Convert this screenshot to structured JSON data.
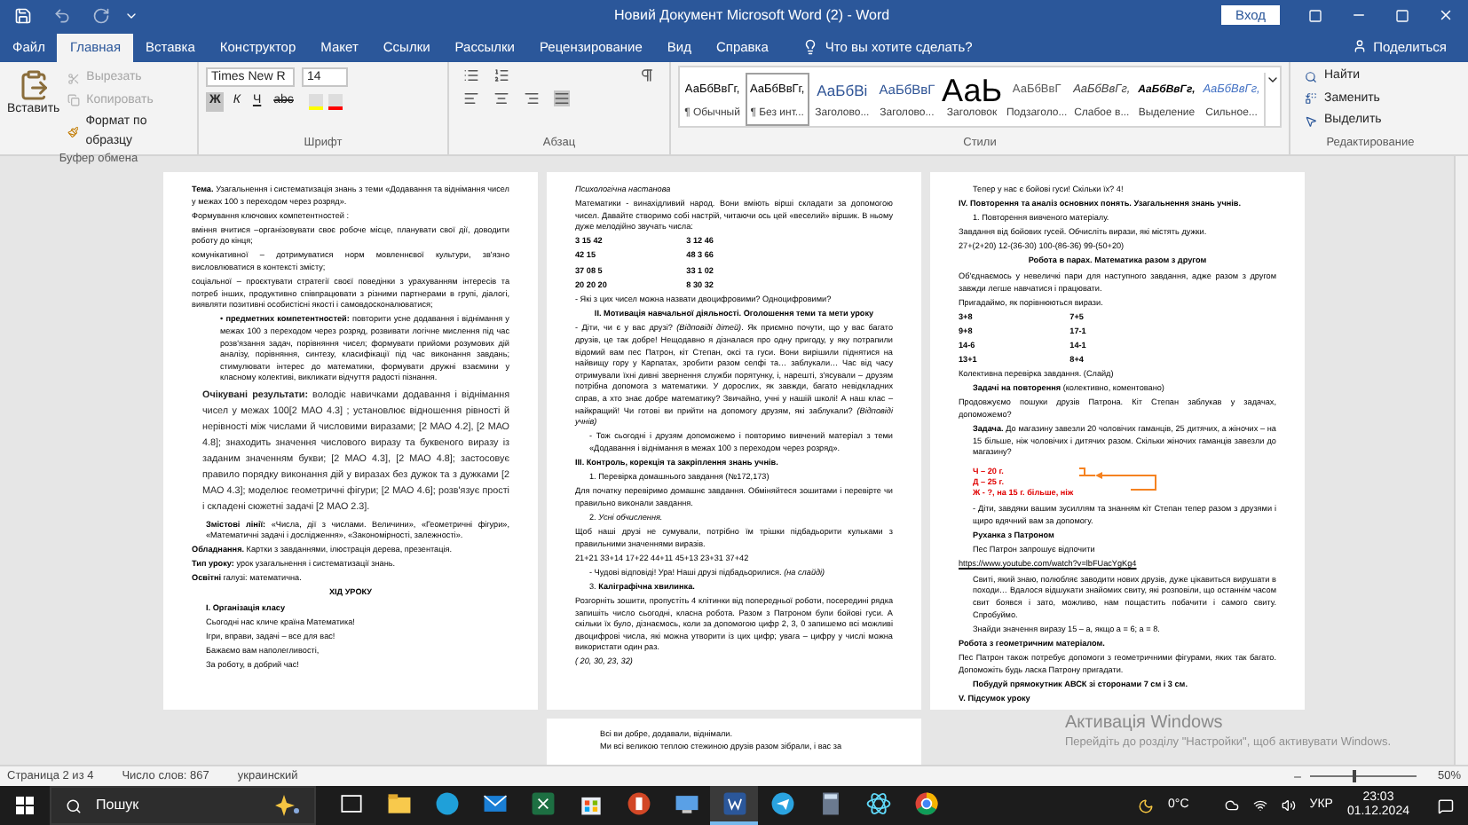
{
  "title_bar": {
    "title": "Новий Документ Microsoft Word (2)  -  Word",
    "sign_in": "Вход"
  },
  "tabs": [
    {
      "label": "Файл",
      "selected": false
    },
    {
      "label": "Главная",
      "selected": true
    },
    {
      "label": "Вставка",
      "selected": false
    },
    {
      "label": "Конструктор",
      "selected": false
    },
    {
      "label": "Макет",
      "selected": false
    },
    {
      "label": "Ссылки",
      "selected": false
    },
    {
      "label": "Рассылки",
      "selected": false
    },
    {
      "label": "Рецензирование",
      "selected": false
    },
    {
      "label": "Вид",
      "selected": false
    },
    {
      "label": "Справка",
      "selected": false
    }
  ],
  "tell_me": "Что вы хотите сделать?",
  "share": "Поделиться",
  "clipboard": {
    "paste": "Вставить",
    "items": [
      {
        "kind": "cut",
        "label": "Вырезать",
        "disabled": true
      },
      {
        "kind": "copy",
        "label": "Копировать",
        "disabled": true
      },
      {
        "kind": "format",
        "label": "Формат по образцу",
        "disabled": false
      }
    ],
    "group": "Буфер обмена"
  },
  "font": {
    "name": "Times New R",
    "size": "14",
    "buttons": [
      {
        "kind": "bold",
        "label": "Ж",
        "selected": true
      },
      {
        "kind": "italic",
        "label": "К",
        "selected": false
      },
      {
        "kind": "underline",
        "label": "Ч",
        "selected": false
      },
      {
        "kind": "strike",
        "label": "abc",
        "selected": false
      }
    ],
    "group": "Шрифт"
  },
  "paragraph": {
    "group": "Абзац"
  },
  "styles": {
    "group": "Стили",
    "items": [
      {
        "kind": "normal",
        "preview": "АаБбВвГг,",
        "label": "¶ Обычный",
        "selected": false
      },
      {
        "kind": "normal",
        "preview": "АаБбВвГг,",
        "label": "¶ Без инт...",
        "selected": true
      },
      {
        "kind": "heading1",
        "preview": "АаБбВі",
        "label": "Заголово...",
        "selected": false
      },
      {
        "kind": "heading2",
        "preview": "АаБбВвГ",
        "label": "Заголово...",
        "selected": false
      },
      {
        "kind": "title",
        "preview": "АаЬ",
        "label": "Заголовок",
        "selected": false
      },
      {
        "kind": "subtitle",
        "preview": "АаБбВвГ",
        "label": "Подзаголо...",
        "selected": false
      },
      {
        "kind": "emphasis",
        "preview": "АаБбВвГг,",
        "label": "Слабое в...",
        "selected": false
      },
      {
        "kind": "strong",
        "preview": "АаБбВвГг,",
        "label": "Выделение",
        "selected": false
      },
      {
        "kind": "intense",
        "preview": "АаБбВвГг,",
        "label": "Сильное...",
        "selected": false
      }
    ]
  },
  "editing": {
    "group": "Редактирование",
    "items": [
      {
        "kind": "find",
        "label": "Найти"
      },
      {
        "kind": "replace",
        "label": "Заменить"
      },
      {
        "kind": "select",
        "label": "Выделить"
      }
    ]
  },
  "pages": [
    {
      "paragraphs": [
        {
          "kind": "p",
          "text": "**Тема.** Узагальнення і систематизація знань з теми «Додавання та віднімання чисел у межах 100 з переходом через розряд»."
        },
        {
          "kind": "p",
          "text": "Формування ключових компетентностей :"
        },
        {
          "kind": "p",
          "text": "вміння вчитися –організовувати своє робоче місце, планувати свої дії, доводити роботу до кінця;"
        },
        {
          "kind": "p",
          "text": "комунікативної – дотримуватися норм мовленнєвої культури, зв'язно висловлюватися в контексті змісту;"
        },
        {
          "kind": "p",
          "text": "соціальної – проєктувати стратегії своєї поведінки з урахуванням інтересів та потреб інших, продуктивно співпрацювати з різними партнерами в групі, діалогі, виявляти позитивні особистісні якості і самовдосконалюватися;"
        },
        {
          "kind": "bullet",
          "text": "• **предметних компетентностей:** повторити усне додавання і віднімання у межах 100 з переходом через розряд, розвивати логічне мислення під час розв'язання задач, порівняння чисел; формувати прийоми розумових дій аналізу, порівняння, синтезу, класифікації під час виконання завдань; стимулювати інтерес до математики, формувати дружні взаємини у класному колективі, викликати відчуття радості пізнання."
        },
        {
          "kind": "wide",
          "text": "**Очікувані результати:** володіє навичками додавання і віднімання чисел у межах 100[2 МАО 4.3] ; установлює відношення рівності й нерівності між числами й числовими виразами; [2 МАО 4.2], [2 МАО 4.8]; знаходить значення числового виразу та буквеного виразу із заданим значенням букви; [2 МАО 4.3], [2 МАО 4.8]; застосовує правило порядку виконання дій у виразах без дужок та з дужками [2 МАО 4.3]; моделює геометричні фігури; [2 МАО 4.6]; розв'язує прості і складені сюжетні задачі [2 МАО 2.3]."
        },
        {
          "kind": "indent",
          "text": "**Змістові лінії:** «Числа, дії з числами. Величини», «Геометричні фігури», «Математичні задачі і дослідження», «Закономірності, залежності»."
        },
        {
          "kind": "p",
          "text": "**Обладнання.** Картки з завданнями, ілюстрація дерева, презентація."
        },
        {
          "kind": "p",
          "text": "**Тип уроку:** урок узагальнення і систематизації знань."
        },
        {
          "kind": "p",
          "text": "**Освітні** галузі: математична."
        },
        {
          "kind": "center",
          "text": "ХІД УРОКУ"
        },
        {
          "kind": "indent",
          "text": "**І. Організація класу**"
        },
        {
          "kind": "indent",
          "text": "Сьогодні нас кличе країна Математика!"
        },
        {
          "kind": "indent",
          "text": "Ігри, вправи, задачі – все для вас!"
        },
        {
          "kind": "indent",
          "text": "Бажаємо вам наполегливості,"
        },
        {
          "kind": "indent",
          "text": "За роботу, в добрий час!"
        }
      ]
    },
    {
      "paragraphs": [
        {
          "kind": "p",
          "text": "*Психологічна настанова*"
        },
        {
          "kind": "p",
          "text": "Математики - винахідливий народ. Вони вміють вірші складати за допомогою чисел. Давайте створимо собі настрій, читаючи ось цей «веселий» віршик. В ньому дуже мелодійно звучать числа:"
        },
        {
          "kind": "columns",
          "text": "3  15  42",
          "second": "3  12  46"
        },
        {
          "kind": "columns",
          "text": "42  15",
          "second": "48  3  66"
        },
        {
          "kind": "columns",
          "text": "37  08  5",
          "second": "33  1  02"
        },
        {
          "kind": "columns",
          "text": "20  20  20",
          "second": "8  30  32"
        },
        {
          "kind": "p",
          "text": "- Які з цих чисел можна назвати двоцифровими? Одноцифровими?"
        },
        {
          "kind": "center",
          "text": "ІІ. Мотивація навчальної діяльності. Оголошення теми та мети уроку"
        },
        {
          "kind": "p",
          "text": "- Діти, чи є у вас друзі? *(Відповіді дітей)*. Як приємно почути, що у вас багато друзів, це так добре! Нещодавно я дізналася про одну пригоду, у яку потрапили відомий вам пес Патрон, кіт Степан, оксі та гуси. Вони вирішили піднятися на найвищу гору у Карпатах, зробити разом селфі та… заблукали… Час від часу отримували їхні дивні звернення служби порятунку, і, нарешті, з'ясували – друзям потрібна допомога з математики. У дорослих, як завжди, багато невідкладних справ, а хто знає добре математику? Звичайно, учні у нашій школі! А наш клас – найкращий! Чи готові ви прийти на допомогу друзям, які заблукали? *(Відповіді учнів)*"
        },
        {
          "kind": "indent",
          "text": "- Тож сьогодні і друзям допоможемо і повторимо вивчений матеріал з теми «Додавання і віднімання в межах 100 з переходом через розряд»."
        },
        {
          "kind": "p",
          "text": "**ІІІ. Контроль, корекція та закріплення знань учнів.**"
        },
        {
          "kind": "indent",
          "text": "1. Перевірка домашнього завдання (№172,173)"
        },
        {
          "kind": "p",
          "text": "Для початку перевіримо домашнє завдання. Обміняйтеся зошитами і перевірте чи правильно виконали завдання."
        },
        {
          "kind": "indent",
          "text": "2. *Усні обчислення.*"
        },
        {
          "kind": "p",
          "text": "Щоб наші друзі не сумували, потрібно їм трішки підбадьорити кульками з правильними значеннями виразів."
        },
        {
          "kind": "p",
          "text": "21+21    33+14    17+22    44+11    45+13    23+31    37+42"
        },
        {
          "kind": "indent",
          "text": "- Чудові відповіді! Ура! Наші друзі підбадьорилися. *(на слайді)*"
        },
        {
          "kind": "indent",
          "text": "3. **Каліграфічна хвилинка.**"
        },
        {
          "kind": "p",
          "text": "Розгорніть зошити, пропустіть 4 клітинки від попередньої роботи, посередині рядка запишіть число сьогодні, класна робота. Разом з Патроном були бойові гуси. А скільки їх було, дізнаємось, коли за допомогою цифр 2, 3, 0 запишемо всі можливі двоцифрові числа, які можна утворити із цих цифр; увага – цифру у числі можна використати один раз."
        },
        {
          "kind": "p",
          "text": "*( 20, 30, 23, 32)*"
        }
      ]
    },
    {
      "paragraphs": [
        {
          "kind": "indent",
          "text": "Тепер у нас є бойові гуси! Скільки їх? 4!"
        },
        {
          "kind": "p",
          "text": "**IV. Повторення та аналіз основних понять. Узагальнення знань учнів.**"
        },
        {
          "kind": "indent",
          "text": "1. Повторення вивченого матеріалу."
        },
        {
          "kind": "p",
          "text": "Завдання від бойових гусей. Обчисліть вирази, які містять дужки."
        },
        {
          "kind": "p",
          "text": "27+(2+20)    12-(36-30)    100-(86-36)    99-(50+20)"
        },
        {
          "kind": "center",
          "text": "Робота в парах. Математика разом з другом"
        },
        {
          "kind": "p",
          "text": "Об'єднаємось у невеличкі пари для наступного завдання, адже разом з другом завжди легше навчатися і працювати."
        },
        {
          "kind": "p",
          "text": "Пригадаймо, як порівнюються вирази."
        },
        {
          "kind": "columns",
          "text": "3+8",
          "second": "7+5"
        },
        {
          "kind": "columns",
          "text": "9+8",
          "second": "17-1"
        },
        {
          "kind": "columns",
          "text": "14-6",
          "second": "14-1"
        },
        {
          "kind": "columns",
          "text": "13+1",
          "second": "8+4"
        },
        {
          "kind": "p",
          "text": "Колективна перевірка завдання. (Слайд)"
        },
        {
          "kind": "indent",
          "text": "**Задачі на повторення** (колективно, коментовано)"
        },
        {
          "kind": "p",
          "text": "Продовжуємо пошуки друзів Патрона. Кіт Степан заблукав у задачах, допоможемо?"
        },
        {
          "kind": "indent",
          "text": "**Задача.** До магазину завезли 20 чоловічих гаманців, 25 дитячих, а жіночих – на 15 більше, ніж чоловічих і дитячих разом. Скільки жіночих гаманців завезли до магазину?"
        },
        {
          "kind": "scheme",
          "lines": [
            "Ч – 20 г.",
            "Д – 25 г.",
            "Ж - ?, на 15 г. більше, ніж"
          ]
        },
        {
          "kind": "indent",
          "text": "- Діти, завдяки вашим зусиллям та знанням кіт Степан тепер разом з друзями і щиро вдячний вам за допомогу."
        },
        {
          "kind": "indent",
          "text": "**Руханка з Патроном**"
        },
        {
          "kind": "indent",
          "text": "Пес Патрон запрошує відпочити"
        },
        {
          "kind": "link",
          "text": "https://www.youtube.com/watch?v=lbFUacYgKg4"
        },
        {
          "kind": "indent",
          "text": "Свиті, який знаю, полюбляє заводити нових друзів, дуже цікавиться вирушати в походи… Вдалося відшукати знайомих свиту, які розповіли, що останнім часом свит боявся і зато, можливо, нам пощастить побачити і самого свиту. Спробуймо."
        },
        {
          "kind": "indent",
          "text": "Знайди значення виразу 15 – а, якщо а = 6; а = 8."
        },
        {
          "kind": "p",
          "text": "**Робота з геометричним матеріалом.**"
        },
        {
          "kind": "p",
          "text": "Пес Патрон також потребує допомоги з геометричними фігурами, яких так багато. Допоможіть будь ласка Патрону пригадати."
        },
        {
          "kind": "indent",
          "text": "**Побудуй прямокутник АВСК зі сторонами 7 см і 3 см.**"
        },
        {
          "kind": "p",
          "text": "**V. Підсумок уроку**"
        }
      ]
    }
  ],
  "last_page": {
    "lines": [
      "Всі ви добре, додавали, віднімали.",
      "Ми всі великою теплою стежиною друзів разом зібрали, і вас за"
    ]
  },
  "activation": {
    "title": "Активація Windows",
    "text": "Перейдіть до розділу \"Настройки\", щоб активувати Windows."
  },
  "status_bar": {
    "page": "Страница 2 из 4",
    "words": "Число слов: 867",
    "language": "украинский",
    "zoom": "50%",
    "zoom_slider": {
      "level": 0.4
    }
  },
  "taskbar": {
    "search": "Пошук",
    "weather": "0°C",
    "language": "УКР",
    "time": "23:03",
    "date": "01.12.2024",
    "apps": [
      {
        "kind": "taskview",
        "selected": false
      },
      {
        "kind": "folder",
        "selected": false
      },
      {
        "kind": "edge",
        "selected": false
      },
      {
        "kind": "mail",
        "selected": false
      },
      {
        "kind": "excel",
        "selected": false
      },
      {
        "kind": "store",
        "selected": false
      },
      {
        "kind": "powerpoint",
        "selected": false
      },
      {
        "kind": "pc",
        "selected": false
      },
      {
        "kind": "word",
        "selected": true
      },
      {
        "kind": "telegram",
        "selected": false
      },
      {
        "kind": "calculator",
        "selected": false
      },
      {
        "kind": "atom",
        "selected": false
      },
      {
        "kind": "chrome",
        "selected": false
      }
    ]
  }
}
